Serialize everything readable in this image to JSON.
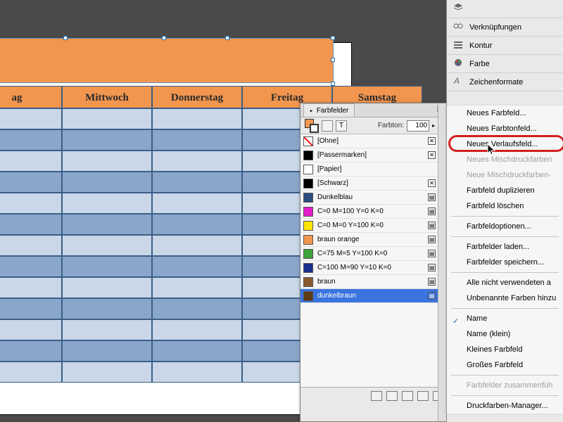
{
  "calendar": {
    "days": [
      "ag",
      "Mittwoch",
      "Donnerstag",
      "Freitag",
      "Samstag"
    ],
    "rows": 13
  },
  "dock": {
    "items": [
      {
        "icon": "layers",
        "label": ""
      },
      {
        "icon": "links",
        "label": "Verknüpfungen"
      },
      {
        "icon": "stroke",
        "label": "Kontur"
      },
      {
        "icon": "color",
        "label": "Farbe"
      },
      {
        "icon": "char",
        "label": "Zeichenformate"
      }
    ]
  },
  "panel": {
    "tab": "Farbfelder",
    "tint_label": "Farbton:",
    "tint_value": "100",
    "tint_unit": "%",
    "swatches": [
      {
        "name": "[Ohne]",
        "chip": "none",
        "flags": [
          "x",
          "strike"
        ]
      },
      {
        "name": "[Passermarken]",
        "chip": "#000",
        "flags": [
          "x",
          "reg"
        ]
      },
      {
        "name": "[Papier]",
        "chip": "#fff",
        "flags": []
      },
      {
        "name": "[Schwarz]",
        "chip": "#000",
        "flags": [
          "x",
          "proc"
        ]
      },
      {
        "name": "Dunkelblau",
        "chip": "#2a4d80",
        "flags": [
          "grad",
          "proc"
        ]
      },
      {
        "name": "C=0 M=100 Y=0 K=0",
        "chip": "#e31ccb",
        "flags": [
          "grad",
          "proc"
        ]
      },
      {
        "name": "C=0 M=0 Y=100 K=0",
        "chip": "#ffe600",
        "flags": [
          "grad",
          "proc"
        ]
      },
      {
        "name": "braun orange",
        "chip": "#f1954f",
        "flags": [
          "grad",
          "proc"
        ]
      },
      {
        "name": "C=75 M=5 Y=100 K=0",
        "chip": "#3da33a",
        "flags": [
          "grad",
          "proc"
        ]
      },
      {
        "name": "C=100 M=90 Y=10 K=0",
        "chip": "#1b2f8f",
        "flags": [
          "grad",
          "proc"
        ]
      },
      {
        "name": "braun",
        "chip": "#8a5a2e",
        "flags": [
          "grad",
          "proc"
        ]
      },
      {
        "name": "dunkelbraun",
        "chip": "#5e3a17",
        "flags": [
          "grad",
          "proc"
        ],
        "selected": true
      }
    ]
  },
  "menu": {
    "groups": [
      [
        {
          "label": "Neues Farbfeld..."
        },
        {
          "label": "Neues Farbtonfeld..."
        },
        {
          "label": "Neues Verlaufsfeld...",
          "highlight": true
        },
        {
          "label": "Neues Mischdruckfarben",
          "disabled": true
        },
        {
          "label": "Neue Mischdruckfarben-",
          "disabled": true
        },
        {
          "label": "Farbfeld duplizieren"
        },
        {
          "label": "Farbfeld löschen"
        }
      ],
      [
        {
          "label": "Farbfeldoptionen..."
        }
      ],
      [
        {
          "label": "Farbfelder laden..."
        },
        {
          "label": "Farbfelder speichern..."
        }
      ],
      [
        {
          "label": "Alle nicht verwendeten a"
        },
        {
          "label": "Unbenannte Farben hinzu"
        }
      ],
      [
        {
          "label": "Name",
          "checked": true
        },
        {
          "label": "Name (klein)"
        },
        {
          "label": "Kleines Farbfeld"
        },
        {
          "label": "Großes Farbfeld"
        }
      ],
      [
        {
          "label": "Farbfelder zusammenfüh",
          "disabled": true
        }
      ],
      [
        {
          "label": "Druckfarben-Manager..."
        }
      ]
    ]
  }
}
